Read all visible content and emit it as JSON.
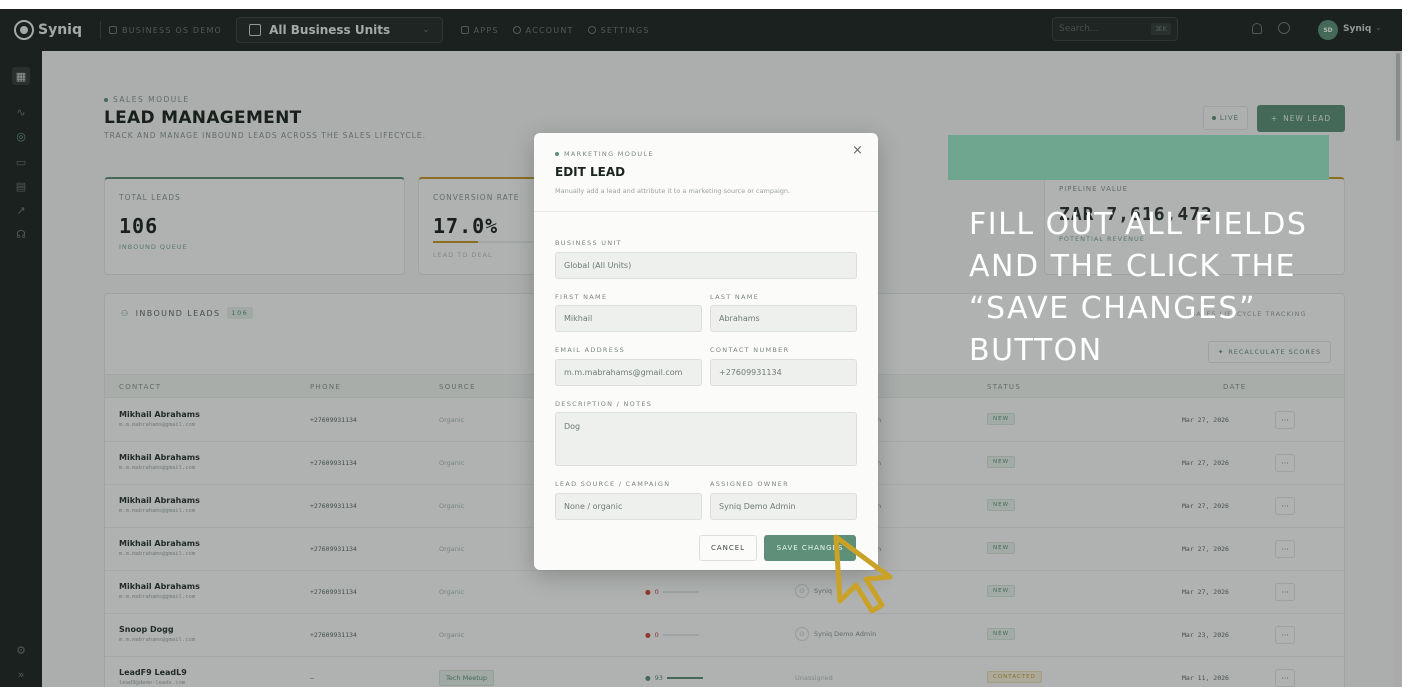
{
  "topbar": {
    "logo": "Syniq",
    "workspace": "BUSINESS OS DEMO",
    "business_unit": "All Business Units",
    "nav": [
      "APPS",
      "ACCOUNT",
      "SETTINGS"
    ],
    "search_placeholder": "Search...",
    "search_shortcut": "⌘K",
    "user_initials": "SD",
    "user_name": "Syniq"
  },
  "page": {
    "breadcrumb": "SALES MODULE",
    "title": "LEAD MANAGEMENT",
    "subtitle": "TRACK AND MANAGE INBOUND LEADS ACROSS THE SALES LIFECYCLE.",
    "live_label": "LIVE",
    "new_lead_label": "NEW LEAD"
  },
  "kpis": [
    {
      "label": "TOTAL LEADS",
      "value": "106",
      "sub": "INBOUND QUEUE"
    },
    {
      "label": "CONVERSION RATE",
      "value": "17.0%",
      "sub": "LEAD TO DEAL",
      "progress": 0.17
    },
    {
      "label": "PIPELINE VALUE",
      "value": "ZAR 7,616,472",
      "sub": "POTENTIAL REVENUE"
    }
  ],
  "table": {
    "title": "INBOUND LEADS",
    "count": "106",
    "right_label": "SALES LIFECYCLE TRACKING",
    "recalc_label": "RECALCULATE SCORES",
    "columns": [
      "CONTACT",
      "PHONE",
      "SOURCE",
      "STATUS",
      "DATE"
    ],
    "rows": [
      {
        "name": "Mikhail Abrahams",
        "email": "m.m.mabrahams@gmail.com",
        "phone": "+27609931134",
        "source": "Organic",
        "owner": "n",
        "status": "NEW",
        "date": "Mar 27, 2026"
      },
      {
        "name": "Mikhail Abrahams",
        "email": "m.m.mabrahams@gmail.com",
        "phone": "+27609931134",
        "source": "Organic",
        "owner": "n",
        "status": "NEW",
        "date": "Mar 27, 2026"
      },
      {
        "name": "Mikhail Abrahams",
        "email": "m.m.mabrahams@gmail.com",
        "phone": "+27609931134",
        "source": "Organic",
        "owner": "n",
        "status": "NEW",
        "date": "Mar 27, 2026"
      },
      {
        "name": "Mikhail Abrahams",
        "email": "m.m.mabrahams@gmail.com",
        "phone": "+27609931134",
        "source": "Organic",
        "owner": "n",
        "status": "NEW",
        "date": "Mar 27, 2026"
      },
      {
        "name": "Mikhail Abrahams",
        "email": "m.m.mabrahams@gmail.com",
        "phone": "+27609931134",
        "source": "Organic",
        "score": "0",
        "owner": "Syniq",
        "status": "NEW",
        "date": "Mar 27, 2026"
      },
      {
        "name": "Snoop Dogg",
        "email": "m.m.mabrahams@gmail.com",
        "phone": "+27609931134",
        "source": "Organic",
        "score": "0",
        "owner": "Syniq Demo Admin",
        "status": "NEW",
        "date": "Mar 23, 2026"
      },
      {
        "name": "LeadF9 LeadL9",
        "email": "lead9@demo-leads.com",
        "phone": "—",
        "source": "Tech Meetup",
        "score": "93",
        "owner": "Unassigned",
        "status": "CONTACTED",
        "date": "Mar 11, 2026"
      }
    ]
  },
  "modal": {
    "breadcrumb": "MARKETING MODULE",
    "title": "EDIT LEAD",
    "subtitle": "Manually add a lead and attribute it to a marketing source or campaign.",
    "close_glyph": "×",
    "business_unit_label": "BUSINESS UNIT",
    "business_unit_value": "Global (All Units)",
    "first_name_label": "FIRST NAME",
    "first_name_value": "Mikhail",
    "last_name_label": "LAST NAME",
    "last_name_value": "Abrahams",
    "email_label": "EMAIL ADDRESS",
    "email_value": "m.m.mabrahams@gmail.com",
    "contact_label": "CONTACT NUMBER",
    "contact_value": "+27609931134",
    "notes_label": "DESCRIPTION / NOTES",
    "notes_value": "Dog",
    "source_label": "LEAD SOURCE / CAMPAIGN",
    "source_value": "None / organic",
    "owner_label": "ASSIGNED OWNER",
    "owner_value": "Syniq Demo Admin",
    "cancel_label": "CANCEL",
    "save_label": "SAVE CHANGES"
  },
  "annotation": {
    "text": "FILL OUT ALL FIELDS AND THE CLICK THE “SAVE CHANGES” BUTTON"
  },
  "colors": {
    "accent": "#5e8f78",
    "callout": "#6fa690",
    "cursor": "#c9a227",
    "dark": "#1e2522"
  }
}
